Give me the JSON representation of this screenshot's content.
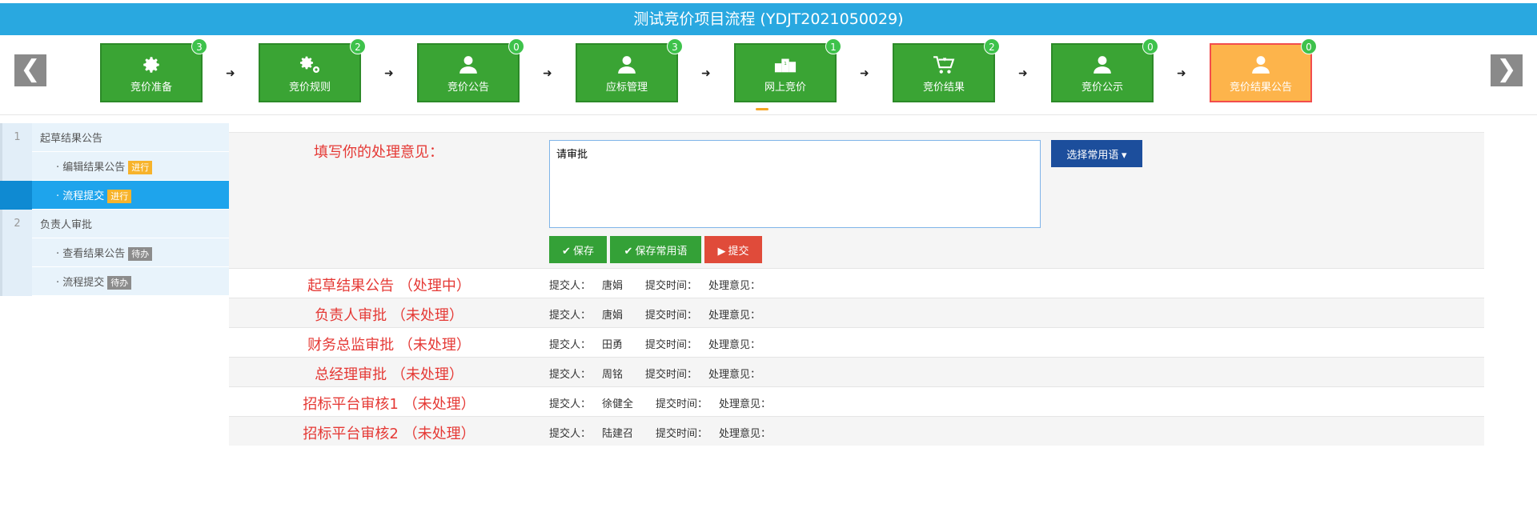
{
  "title": "测试竞价项目流程 (YDJT2021050029)",
  "nav": {
    "prev": "❮",
    "next": "❯"
  },
  "steps": [
    {
      "label": "竞价准备",
      "count": "3",
      "icon": "gear-icon"
    },
    {
      "label": "竞价规则",
      "count": "2",
      "icon": "gears-icon"
    },
    {
      "label": "竞价公告",
      "count": "0",
      "icon": "user-icon"
    },
    {
      "label": "应标管理",
      "count": "3",
      "icon": "user-icon"
    },
    {
      "label": "网上竞价",
      "count": "1",
      "icon": "podium-icon"
    },
    {
      "label": "竞价结果",
      "count": "2",
      "icon": "cart-icon"
    },
    {
      "label": "竞价公示",
      "count": "0",
      "icon": "user-icon"
    },
    {
      "label": "竞价结果公告",
      "count": "0",
      "icon": "user-icon",
      "active": true
    }
  ],
  "sidebar": {
    "groups": [
      {
        "num": "1",
        "label": "起草结果公告",
        "items": [
          {
            "label": "· 编辑结果公告",
            "tag": "进行"
          },
          {
            "label": "· 流程提交",
            "tag": "进行",
            "selected": true
          }
        ]
      },
      {
        "num": "2",
        "label": "负责人审批",
        "items": [
          {
            "label": "· 查看结果公告",
            "tag": "待办"
          },
          {
            "label": "· 流程提交",
            "tag": "待办"
          }
        ]
      }
    ]
  },
  "form": {
    "label": "填写你的处理意见：",
    "opinion_value": "请审批",
    "phrase_button": "选择常用语",
    "save": "保存",
    "save_phrase": "保存常用语",
    "submit": "提交"
  },
  "records_labels": {
    "submitter": "提交人：",
    "time": "提交时间：",
    "opinion": "处理意见："
  },
  "records": [
    {
      "title": "起草结果公告 （处理中）",
      "submitter": "唐娟"
    },
    {
      "title": "负责人审批 （未处理）",
      "submitter": "唐娟"
    },
    {
      "title": "财务总监审批 （未处理）",
      "submitter": "田勇"
    },
    {
      "title": "总经理审批 （未处理）",
      "submitter": "周铭"
    },
    {
      "title": "招标平台审核1 （未处理）",
      "submitter": "徐健全"
    },
    {
      "title": "招标平台审核2 （未处理）",
      "submitter": "陆建召"
    }
  ],
  "colors": {
    "header": "#29a8e0",
    "step": "#3aa434",
    "step_active": "#fdb44b",
    "accent_red": "#e53935"
  }
}
